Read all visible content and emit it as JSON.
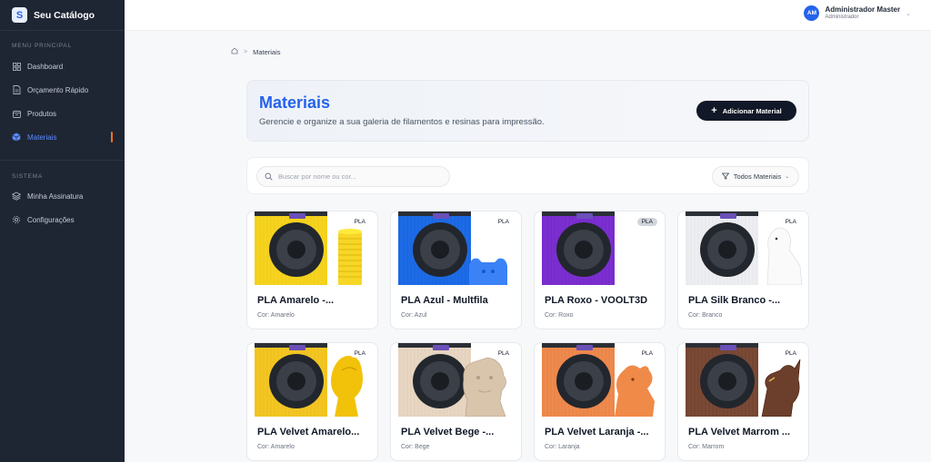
{
  "brand": {
    "logo_letter": "S",
    "name": "Seu Catálogo"
  },
  "sidebar": {
    "section_main": "MENU PRINCIPAL",
    "main_items": [
      {
        "label": "Dashboard",
        "icon": "dashboard-icon"
      },
      {
        "label": "Orçamento Rápido",
        "icon": "document-icon"
      },
      {
        "label": "Produtos",
        "icon": "box-icon"
      },
      {
        "label": "Materiais",
        "icon": "cube-icon",
        "active": true
      }
    ],
    "section_system": "SISTEMA",
    "system_items": [
      {
        "label": "Minha Assinatura",
        "icon": "layers-icon"
      },
      {
        "label": "Configurações",
        "icon": "gear-icon"
      }
    ]
  },
  "topbar": {
    "avatar_initials": "AM",
    "user_name": "Administrador Master",
    "user_role": "Administrador"
  },
  "breadcrumb": {
    "current": "Materiais"
  },
  "header": {
    "title": "Materiais",
    "subtitle": "Gerencie e organize a sua galeria de filamentos e resinas para impressão.",
    "add_button": "Adicionar Material"
  },
  "filters": {
    "search_placeholder": "Buscar por nome ou cor...",
    "filter_label": "Todos Materiais"
  },
  "materials": [
    {
      "badge": "PLA",
      "title": "PLA Amarelo -...",
      "color": "Cor: Amarelo",
      "spool": "#f5d31f",
      "object": "#f8d628",
      "obj_shape": "vase"
    },
    {
      "badge": "PLA",
      "title": "PLA Azul - Multfila",
      "color": "Cor: Azul",
      "spool": "#1e6be6",
      "object": "#3b82f6",
      "obj_shape": "block"
    },
    {
      "badge": "PLA",
      "title": "PLA Roxo - VOOLT3D",
      "color": "Cor: Roxo",
      "spool": "#7b2fd0",
      "object": "none",
      "obj_shape": "none"
    },
    {
      "badge": "PLA",
      "title": "PLA Silk Branco -...",
      "color": "Cor: Branco",
      "spool": "#eceef1",
      "object": "#fafafa",
      "obj_shape": "bear"
    },
    {
      "badge": "PLA",
      "title": "PLA Velvet Amarelo...",
      "color": "Cor: Amarelo",
      "spool": "#f3c623",
      "object": "#f2c20a",
      "obj_shape": "trophy"
    },
    {
      "badge": "PLA",
      "title": "PLA Velvet Bege -...",
      "color": "Cor: Bege",
      "spool": "#e8d6c2",
      "object": "#d9c4ac",
      "obj_shape": "head"
    },
    {
      "badge": "PLA",
      "title": "PLA Velvet Laranja -...",
      "color": "Cor: Laranja",
      "spool": "#ee8a4d",
      "object": "#f08a48",
      "obj_shape": "dragon"
    },
    {
      "badge": "PLA",
      "title": "PLA Velvet Marrom ...",
      "color": "Cor: Marrom",
      "spool": "#7a4a36",
      "object": "#6b3f2c",
      "obj_shape": "eagle"
    }
  ]
}
